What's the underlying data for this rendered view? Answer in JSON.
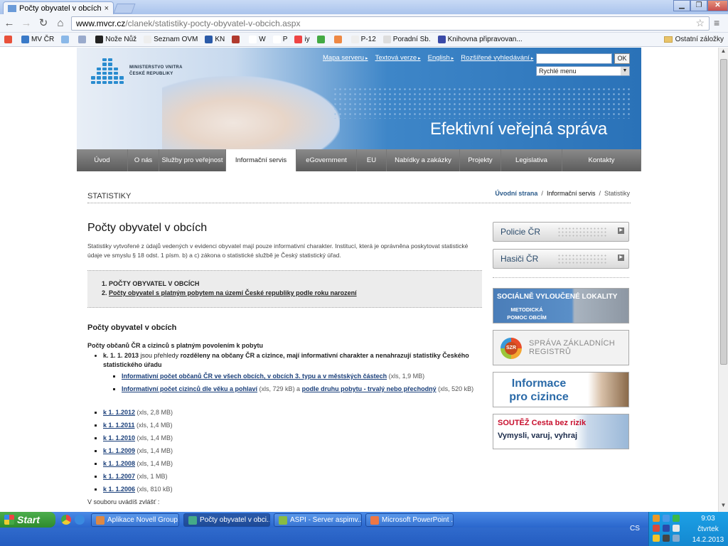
{
  "browser": {
    "tab_title": "Počty obyvatel v obcích - Mi",
    "tab_close": "×",
    "url_host": "www.mvcr.cz",
    "url_path": "/clanek/statistiky-pocty-obyvatel-v-obcich.aspx",
    "window_min": "▁",
    "window_max": "❐",
    "window_close": "✕",
    "back": "←",
    "forward": "→",
    "reload": "↻",
    "home": "⌂",
    "star": "☆",
    "menu": "≡"
  },
  "bookmarks": [
    {
      "label": "",
      "color": "#e8503a"
    },
    {
      "label": "MV ČR",
      "color": "#3a7ac8"
    },
    {
      "label": "",
      "color": "#8ab8e8"
    },
    {
      "label": "",
      "color": "#9ac"
    },
    {
      "label": "Nože Nůž",
      "color": "#222"
    },
    {
      "label": "Seznam OVM",
      "color": "#eee"
    },
    {
      "label": "KN",
      "color": "#2a5aa8"
    },
    {
      "label": "",
      "color": "#b03a2e"
    },
    {
      "label": "W",
      "color": "#fff"
    },
    {
      "label": "P",
      "color": "#fff"
    },
    {
      "label": "iy",
      "color": "#e44"
    },
    {
      "label": "",
      "color": "#4a4"
    },
    {
      "label": "",
      "color": "#e84"
    },
    {
      "label": "P-12",
      "color": "#eee"
    },
    {
      "label": "Poradní Sb.",
      "color": "#ddd"
    },
    {
      "label": "Knihovna připravovan...",
      "color": "#3a4aa8"
    }
  ],
  "bookmarks_other": "Ostatní záložky",
  "header": {
    "logo_line1": "MINISTERSTVO VNITRA",
    "logo_line2": "ČESKÉ REPUBLIKY",
    "topnav": [
      "Mapa serveru",
      "Textová verze",
      "English",
      "Rozšířené vyhledávání"
    ],
    "search_value": "",
    "search_button": "OK",
    "quick_menu": "Rychlé menu",
    "slogan": "Efektivní veřejná správa"
  },
  "mainnav": [
    {
      "label": "Úvod",
      "active": false
    },
    {
      "label": "O nás",
      "active": false
    },
    {
      "label": "Služby pro veřejnost",
      "active": false
    },
    {
      "label": "Informační servis",
      "active": true
    },
    {
      "label": "eGovernment",
      "active": false
    },
    {
      "label": "EU",
      "active": false
    },
    {
      "label": "Nabídky a zakázky",
      "active": false
    },
    {
      "label": "Projekty",
      "active": false
    },
    {
      "label": "Legislativa",
      "active": false
    },
    {
      "label": "Kontakty",
      "active": false
    }
  ],
  "section": {
    "heading": "STATISTIKY",
    "breadcrumb": [
      "Úvodní strana",
      "Informační servis",
      "Statistiky"
    ]
  },
  "article": {
    "title": "Počty obyvatel v obcích",
    "intro": "Statistiky vytvořené z údajů vedených v evidenci obyvatel mají pouze informativní charakter. Institucí, která je oprávněna poskytovat statistické údaje ve smyslu § 18 odst. 1 písm. b) a c) zákona o statistické službě je Český statistický úřad.",
    "toc": [
      "POČTY OBYVATEL V OBCÍCH",
      "Počty obyvatel s platným pobytem na území České republiky podle roku narození"
    ],
    "h2": "Počty obyvatel v obcích",
    "sub_heading": "Počty občanů ČR a cizinců s platným povolením k pobytu",
    "item_date": "k. 1. 1. 2013",
    "item_text_1": " jsou přehledy ",
    "item_bold": "rozděleny na občany ČR a cizince, mají informativní charakter a nenahrazují statistiky Českého statistického úřadu",
    "link1": "Informativní počet občanů ČR ve všech obcích, v obcích 3. typu a v městských částech",
    "link1_meta": " (xls, 1,9 MB)",
    "link2": "Informativní počet cizinců dle věku a pohlaví",
    "link2_meta": " (xls, 729 kB) a ",
    "link3": "podle druhu pobytu - trvalý nebo přechodný",
    "link3_meta": " (xls, 520 kB)",
    "years": [
      {
        "label": "k 1. 1.2012",
        "meta": " (xls, 2,8 MB)"
      },
      {
        "label": "k 1. 1.2011",
        "meta": " (xls, 1,4 MB)"
      },
      {
        "label": "k 1. 1.2010",
        "meta": " (xls, 1,4 MB)"
      },
      {
        "label": "k 1. 1.2009",
        "meta": " (xls, 1,4 MB)"
      },
      {
        "label": "k 1. 1.2008",
        "meta": " (xls, 1,4 MB)"
      },
      {
        "label": "k 1. 1.2007",
        "meta": " (xls, 1 MB)"
      },
      {
        "label": "k 1. 1.2006",
        "meta": " (xls, 810 kB)"
      }
    ],
    "zvlast": "V souboru uvádíš zvlášť :"
  },
  "sidebar": {
    "btn1": "Policie ČR",
    "btn2": "Hasiči ČR",
    "banner1_main": "SOCIÁLNĚ VYLOUČENÉ LOKALITY",
    "banner1_sub": "METODICKÁ POMOC OBCÍM",
    "banner2_logo": "SZR",
    "banner2_main": "SPRÁVA ZÁKLADNÍCH REGISTRŮ",
    "banner3_main": "Informace pro cizince",
    "banner4_main": "SOUTĚŽ Cesta bez rizik",
    "banner4_sub": "Vymysli, varuj, vyhraj"
  },
  "taskbar": {
    "start": "Start",
    "tasks": [
      {
        "label": "Aplikace Novell Group...",
        "color": "#d84",
        "active": false
      },
      {
        "label": "Počty obyvatel v obci...",
        "color": "#4a8",
        "active": true
      },
      {
        "label": "ASPI - Server aspimv...",
        "color": "#8b4",
        "active": false
      },
      {
        "label": "Microsoft PowerPoint ...",
        "color": "#e74",
        "active": false
      }
    ],
    "lang": "CS",
    "time": "9:03",
    "day": "čtvrtek",
    "date": "14.2.2013"
  }
}
